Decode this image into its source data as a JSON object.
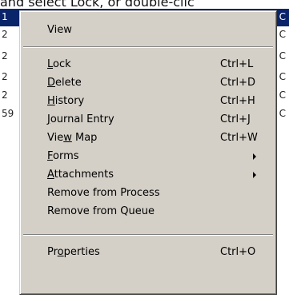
{
  "caption": "and select Lock, or double-clic",
  "background_rows": [
    {
      "left": "1",
      "right": "C",
      "selected": true
    },
    {
      "left": "2",
      "right": "C",
      "selected": false
    },
    {
      "left": "2",
      "right": "C",
      "selected": false
    },
    {
      "left": "2",
      "right": "C",
      "selected": false
    },
    {
      "left": "2",
      "right": "C",
      "selected": false
    },
    {
      "left": "59",
      "right": "C",
      "selected": false
    }
  ],
  "menu": {
    "items": [
      {
        "pre": "",
        "key": "",
        "post": "View",
        "shortcut": ""
      },
      {
        "pre": "",
        "key": "L",
        "post": "ock",
        "shortcut": "Ctrl+L"
      },
      {
        "pre": "",
        "key": "D",
        "post": "elete",
        "shortcut": "Ctrl+D"
      },
      {
        "pre": "",
        "key": "H",
        "post": "istory",
        "shortcut": "Ctrl+H"
      },
      {
        "pre": "",
        "key": "J",
        "post": "ournal Entry",
        "shortcut": "Ctrl+J"
      },
      {
        "pre": "Vie",
        "key": "w",
        "post": " Map",
        "shortcut": "Ctrl+W"
      },
      {
        "pre": "",
        "key": "F",
        "post": "orms",
        "shortcut": ""
      },
      {
        "pre": "",
        "key": "A",
        "post": "ttachments",
        "shortcut": ""
      },
      {
        "pre": "",
        "key": "",
        "post": "Remove from Process",
        "shortcut": ""
      },
      {
        "pre": "",
        "key": "",
        "post": "Remove from Queue",
        "shortcut": ""
      },
      {
        "pre": "Pr",
        "key": "o",
        "post": "perties",
        "shortcut": "Ctrl+O"
      }
    ]
  }
}
